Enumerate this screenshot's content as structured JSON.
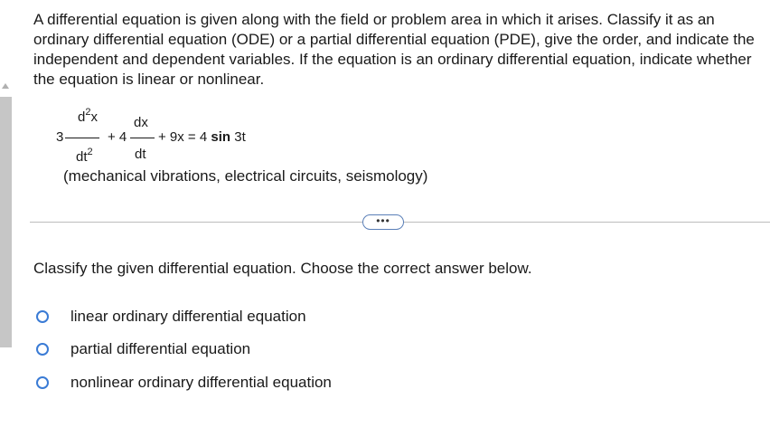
{
  "question": {
    "text": "A differential equation is given along with the field or problem area in which it arises. Classify it as an ordinary differential equation (ODE) or a partial differential equation (PDE), give the order, and indicate the independent and dependent variables. If the equation is an ordinary differential equation, indicate whether the equation is linear or nonlinear."
  },
  "equation": {
    "coef1": "3",
    "num1_base": "d",
    "num1_exp": "2",
    "num1_var": "x",
    "den1_base": "dt",
    "den1_exp": "2",
    "plus_coef2": "+ 4",
    "num2": "dx",
    "den2": "dt",
    "rest_prefix": "+ 9x = 4 ",
    "sin": "sin",
    "rest_suffix": " 3t"
  },
  "field": "(mechanical vibrations, electrical circuits, seismology)",
  "more_button": "•••",
  "prompt": "Classify the given differential equation. Choose the correct answer below.",
  "options": [
    {
      "label": "linear ordinary differential equation"
    },
    {
      "label": "partial differential equation"
    },
    {
      "label": "nonlinear ordinary differential equation"
    }
  ],
  "colors": {
    "radio_border": "#3a7bd5",
    "divider": "#bdbdbd",
    "scroll_thumb": "#c6c6c6"
  }
}
